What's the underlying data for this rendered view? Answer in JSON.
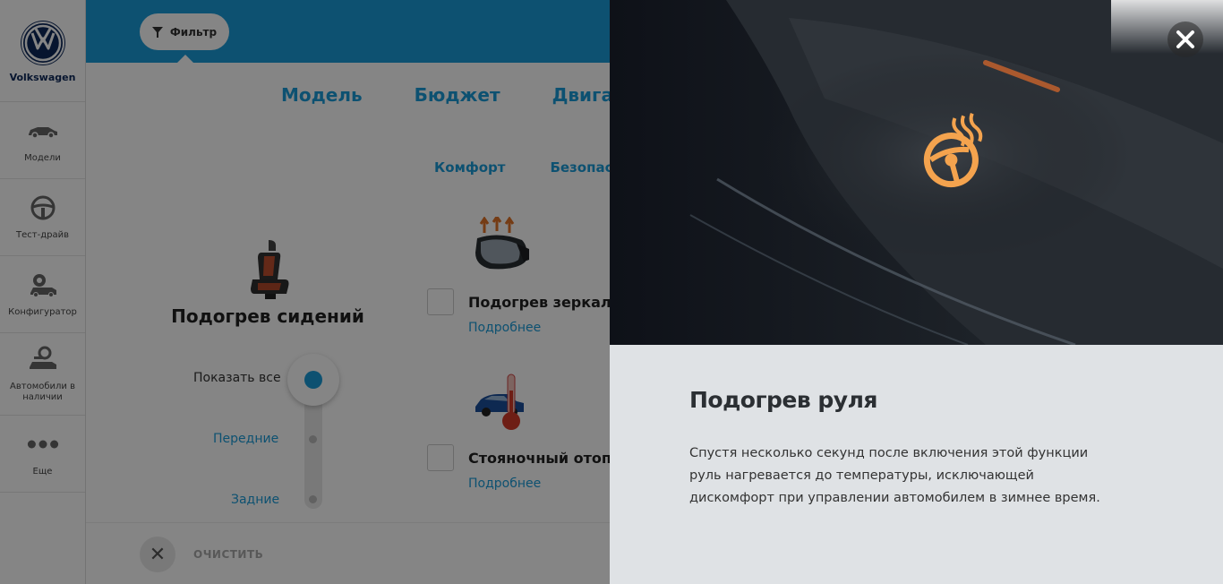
{
  "brand": {
    "name": "Volkswagen",
    "color": "#0f2a5a"
  },
  "sidebar": {
    "items": [
      {
        "label": "Модели",
        "icon": "car-icon"
      },
      {
        "label": "Тест-драйв",
        "icon": "steering-wheel-icon"
      },
      {
        "label": "Конфигуратор",
        "icon": "car-settings-icon"
      },
      {
        "label": "Автомобили в наличии",
        "icon": "car-key-icon"
      },
      {
        "label": "Еще",
        "icon": "more-dots-icon"
      }
    ]
  },
  "topbar": {
    "filter_label": "Фильтр",
    "accent": "#1a9cd8"
  },
  "tabs": [
    "Модель",
    "Бюджет",
    "Двигатель"
  ],
  "subtabs": [
    "Комфорт",
    "Безопасность"
  ],
  "card": {
    "title": "Подогрев сидений",
    "show_all": "Показать все",
    "front": "Передние",
    "back": "Задние"
  },
  "options": [
    {
      "label": "Подогрев зеркал",
      "more": "Подробнее",
      "icon": "heated-mirror-icon"
    },
    {
      "label": "Стояночный отопитель",
      "more": "Подробнее",
      "icon": "parking-heater-icon"
    }
  ],
  "bottom": {
    "clear_label": "ОЧИСТИТЬ"
  },
  "modal": {
    "title": "Подогрев руля",
    "text": "Спустя несколько секунд после включения этой функции руль нагревается до температуры, исключающей дискомфорт при управлении автомобилем в зимнее время.",
    "photo_icon": "heated-steering-wheel-icon"
  }
}
